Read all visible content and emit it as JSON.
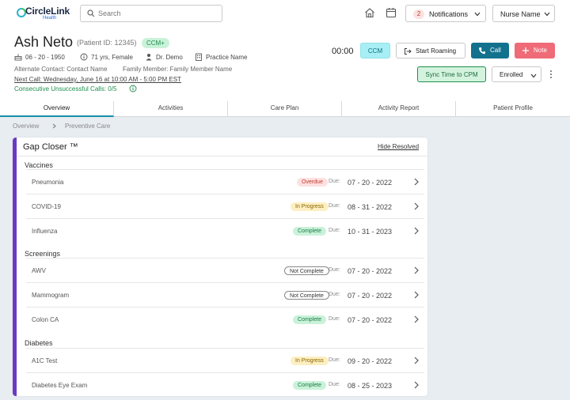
{
  "header": {
    "brand": "CircleLink",
    "brand_sub": "Health",
    "search_placeholder": "Search",
    "notifications_count": "2",
    "notifications_label": "Notifications",
    "user_label": "Nurse Name"
  },
  "patient": {
    "name": "Ash Neto",
    "id_text": "(Patient ID: 12345)",
    "program_badge": "CCM+",
    "dob": "06 - 20 - 1950",
    "age_sex": "71 yrs, Female",
    "doctor": "Dr. Demo",
    "practice": "Practice Name",
    "alt_contact": "Alternate Contact: Contact Name",
    "family_member": "Family Member: Family Member Name",
    "next_call": "Next Call: Wednesday, June 16 at 10:00 AM - 5:00 PM EST",
    "unsuccessful_calls": "Consecutive Unsuccessful Calls: 0/5"
  },
  "actions": {
    "timer": "00:00",
    "ccm": "CCM",
    "start_roaming": "Start Roaming",
    "call": "Call",
    "note": "Note",
    "sync": "Sync Time to CPM",
    "enrollment": "Enrolled"
  },
  "tabs": [
    "Overview",
    "Activities",
    "Care Plan",
    "Activity Report",
    "Patient Profile"
  ],
  "active_tab": "Overview",
  "breadcrumb": [
    "Overview",
    "Preventive Care"
  ],
  "gap_closer": {
    "title": "Gap Closer ™",
    "hide_resolved": "Hide Resolved",
    "due_label": "Due:",
    "sections": [
      {
        "name": "Vaccines",
        "items": [
          {
            "name": "Pneumonia",
            "status": "Overdue",
            "kind": "overdue",
            "due": "07 - 20 - 2022"
          },
          {
            "name": "COVID-19",
            "status": "In Progress",
            "kind": "progress",
            "due": "08 - 31 - 2022"
          },
          {
            "name": "Influenza",
            "status": "Complete",
            "kind": "complete",
            "due": "10 - 31 - 2023"
          }
        ]
      },
      {
        "name": "Screenings",
        "items": [
          {
            "name": "AWV",
            "status": "Not Complete",
            "kind": "notcomplete",
            "due": "07 - 20 - 2022"
          },
          {
            "name": "Mammogram",
            "status": "Not Complete",
            "kind": "notcomplete",
            "due": "07 - 20 - 2022"
          },
          {
            "name": "Colon CA",
            "status": "Complete",
            "kind": "complete",
            "due": "07 - 20 - 2022"
          }
        ]
      },
      {
        "name": "Diabetes",
        "items": [
          {
            "name": "A1C Test",
            "status": "In Progress",
            "kind": "progress",
            "due": "09 - 20 - 2022"
          },
          {
            "name": "Diabetes Eye Exam",
            "status": "Complete",
            "kind": "complete",
            "due": "08 - 25 - 2023"
          }
        ]
      }
    ]
  },
  "colors": {
    "accent_teal": "#12728e",
    "note_red": "#ef6b77",
    "card_stripe": "#6a3ac5",
    "success_green": "#1e8e4e"
  }
}
